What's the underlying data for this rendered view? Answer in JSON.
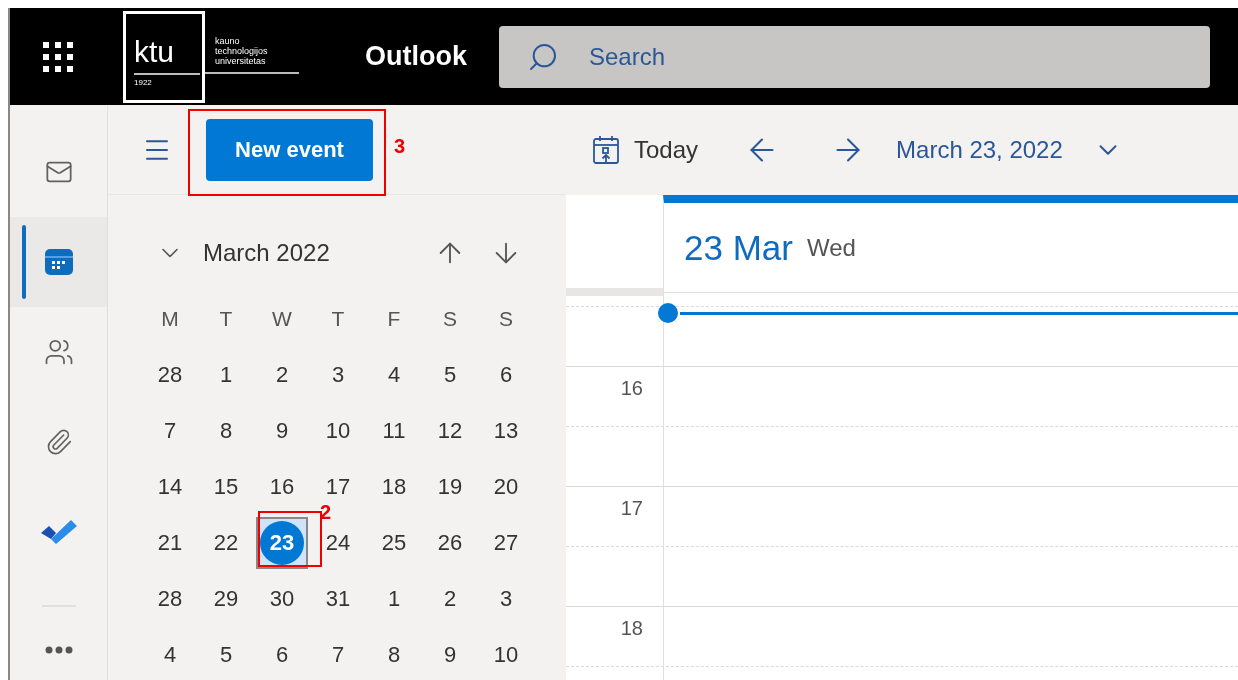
{
  "top_bar": {
    "logo": {
      "mark": "ktu",
      "year": "1922",
      "name_lines": [
        "kauno",
        "technologijos",
        "universitetas"
      ]
    },
    "app_title": "Outlook",
    "search": {
      "placeholder": "Search"
    }
  },
  "nav_rail": {
    "items": [
      {
        "kind": "mail",
        "selected": false
      },
      {
        "kind": "calendar",
        "selected": true
      },
      {
        "kind": "people",
        "selected": false
      },
      {
        "kind": "files",
        "selected": false
      },
      {
        "kind": "todo",
        "selected": false
      }
    ]
  },
  "new_event": {
    "label": "New event",
    "annotation": "3"
  },
  "mini_calendar": {
    "title": "March 2022",
    "weekdays": [
      "M",
      "T",
      "W",
      "T",
      "F",
      "S",
      "S"
    ],
    "weeks": [
      [
        {
          "day": "28",
          "selected": false
        },
        {
          "day": "1",
          "selected": false
        },
        {
          "day": "2",
          "selected": false
        },
        {
          "day": "3",
          "selected": false
        },
        {
          "day": "4",
          "selected": false
        },
        {
          "day": "5",
          "selected": false
        },
        {
          "day": "6",
          "selected": false
        }
      ],
      [
        {
          "day": "7",
          "selected": false
        },
        {
          "day": "8",
          "selected": false
        },
        {
          "day": "9",
          "selected": false
        },
        {
          "day": "10",
          "selected": false
        },
        {
          "day": "11",
          "selected": false
        },
        {
          "day": "12",
          "selected": false
        },
        {
          "day": "13",
          "selected": false
        }
      ],
      [
        {
          "day": "14",
          "selected": false
        },
        {
          "day": "15",
          "selected": false
        },
        {
          "day": "16",
          "selected": false
        },
        {
          "day": "17",
          "selected": false
        },
        {
          "day": "18",
          "selected": false
        },
        {
          "day": "19",
          "selected": false
        },
        {
          "day": "20",
          "selected": false
        }
      ],
      [
        {
          "day": "21",
          "selected": false
        },
        {
          "day": "22",
          "selected": false
        },
        {
          "day": "23",
          "selected": true,
          "annotation": "2"
        },
        {
          "day": "24",
          "selected": false
        },
        {
          "day": "25",
          "selected": false
        },
        {
          "day": "26",
          "selected": false
        },
        {
          "day": "27",
          "selected": false
        }
      ],
      [
        {
          "day": "28",
          "selected": false
        },
        {
          "day": "29",
          "selected": false
        },
        {
          "day": "30",
          "selected": false
        },
        {
          "day": "31",
          "selected": false
        },
        {
          "day": "1",
          "selected": false
        },
        {
          "day": "2",
          "selected": false
        },
        {
          "day": "3",
          "selected": false
        }
      ],
      [
        {
          "day": "4",
          "selected": false
        },
        {
          "day": "5",
          "selected": false
        },
        {
          "day": "6",
          "selected": false
        },
        {
          "day": "7",
          "selected": false
        },
        {
          "day": "8",
          "selected": false
        },
        {
          "day": "9",
          "selected": false
        },
        {
          "day": "10",
          "selected": false
        }
      ]
    ]
  },
  "toolbar": {
    "today": "Today",
    "date": "March 23, 2022"
  },
  "day_view": {
    "date": "23 Mar",
    "weekday": "Wed",
    "hours": [
      "16",
      "17",
      "18"
    ]
  }
}
